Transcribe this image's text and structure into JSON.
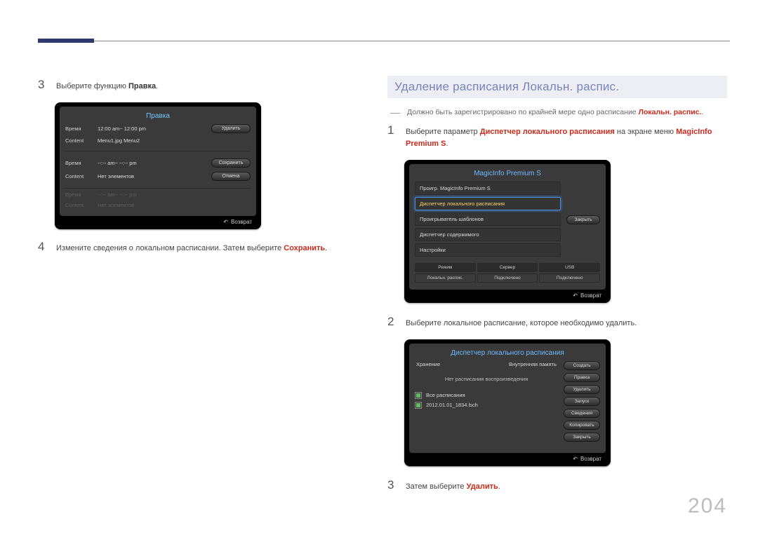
{
  "page_number": "204",
  "left": {
    "step3_label": "3",
    "step3_text_pre": "Выберите функцию ",
    "step3_text_em": "Правка",
    "step4_label": "4",
    "step4_text_pre": "Измените сведения о локальном расписании. Затем выберите ",
    "step4_text_em": "Сохранить",
    "pravka": {
      "title": "Правка",
      "rows": [
        {
          "l": "Время",
          "v": "12:00 am~ 12:00 pm"
        },
        {
          "l": "Content",
          "v": "Menu1.jpg Menu2"
        },
        {
          "l": "Время",
          "v": "--:-- am~ --:-- pm"
        },
        {
          "l": "Content",
          "v": "Нет элементов"
        },
        {
          "l": "Время",
          "v": "--:-- am~ --:-- pm"
        },
        {
          "l": "Content",
          "v": "Нет элементов"
        }
      ],
      "btn_del": "Удалить",
      "btn_save": "Сохранить",
      "btn_cancel": "Отмена",
      "return": "Возврат"
    }
  },
  "right": {
    "title": "Удаление расписания Локальн. распис.",
    "note_pre": "Должно быть зарегистрировано по крайней мере одно расписание ",
    "note_em": "Локальн. распис.",
    "s1_label": "1",
    "s1_t1": "Выберите параметр ",
    "s1_em1": "Диспетчер локального расписания",
    "s1_t2": " на экране меню ",
    "s1_em2": "MagicInfo Premium S",
    "s2_label": "2",
    "s2_text": "Выберите локальное расписание, которое необходимо удалить.",
    "s3_label": "3",
    "s3_t1": "Затем выберите ",
    "s3_em": "Удалить",
    "magic": {
      "title": "MagicInfo Premium S",
      "items": [
        "Проигр. MagicInfo Premium S",
        "Диспетчер локального расписания",
        "Проигрыватель шаблонов",
        "Диспетчер содержимого",
        "Настройки"
      ],
      "close": "Закрыть",
      "cols": [
        "Режим",
        "Сервер",
        "USB"
      ],
      "vals": [
        "Локальн. распис.",
        "Подключено",
        "Подключено"
      ],
      "return": "Возврат"
    },
    "disp": {
      "title": "Диспетчер локального расписания",
      "store_l": "Хранение",
      "store_v": "Внутренняя память",
      "msg": "Нет расписания воспроизведения",
      "row_all": "Все расписания",
      "row_file": "2012.01.01_1834.lsch",
      "buttons": [
        "Создать",
        "Правка",
        "Удалить",
        "Запуск",
        "Сведения",
        "Копировать",
        "Закрыть"
      ],
      "return": "Возврат"
    }
  }
}
